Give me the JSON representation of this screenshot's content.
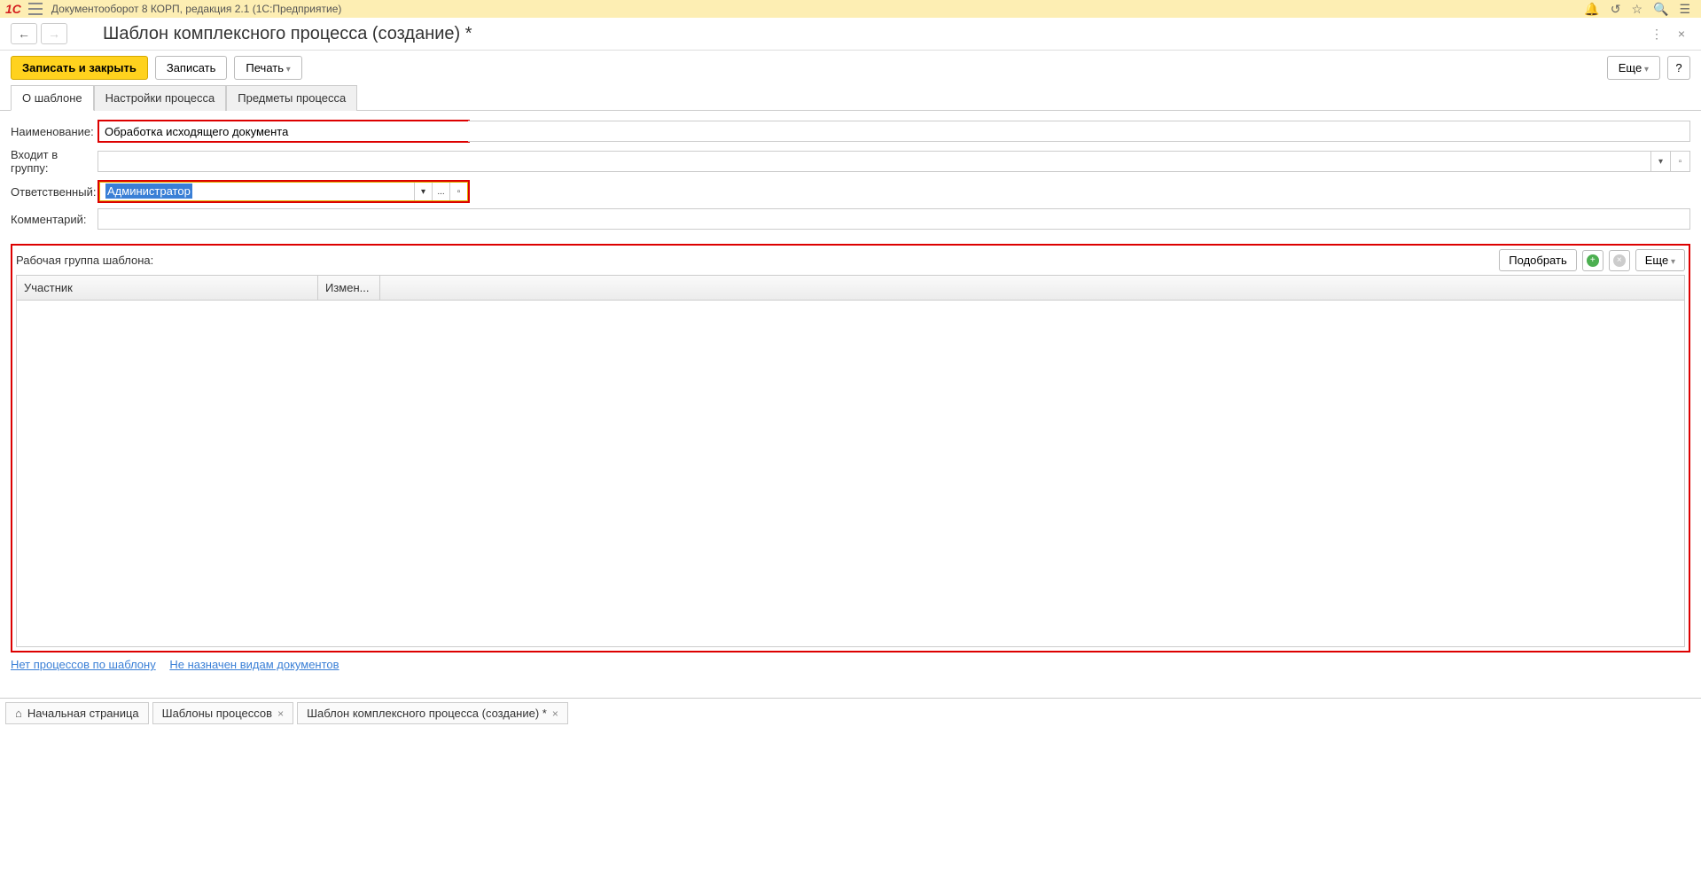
{
  "titlebar": {
    "app_title": "Документооборот 8 КОРП, редакция 2.1  (1С:Предприятие)",
    "logo": "1C"
  },
  "header": {
    "page_title": "Шаблон комплексного процесса (создание) *"
  },
  "toolbar": {
    "save_close": "Записать и закрыть",
    "save": "Записать",
    "print": "Печать",
    "more": "Еще",
    "help": "?"
  },
  "tabs": {
    "about": "О шаблоне",
    "settings": "Настройки процесса",
    "subjects": "Предметы процесса"
  },
  "form": {
    "name_label": "Наименование:",
    "name_value": "Обработка исходящего документа",
    "group_label": "Входит в группу:",
    "group_value": "",
    "responsible_label": "Ответственный:",
    "responsible_value": "Администратор",
    "comment_label": "Комментарий:",
    "comment_value": ""
  },
  "workgroup": {
    "label": "Рабочая группа шаблона:",
    "select_btn": "Подобрать",
    "more_btn": "Еще",
    "col_participant": "Участник",
    "col_change": "Измен..."
  },
  "links": {
    "no_processes": "Нет процессов по шаблону",
    "not_assigned": "Не назначен видам документов"
  },
  "bottom_tabs": {
    "home": "Начальная страница",
    "templates": "Шаблоны процессов",
    "current": "Шаблон комплексного процесса (создание) *"
  }
}
